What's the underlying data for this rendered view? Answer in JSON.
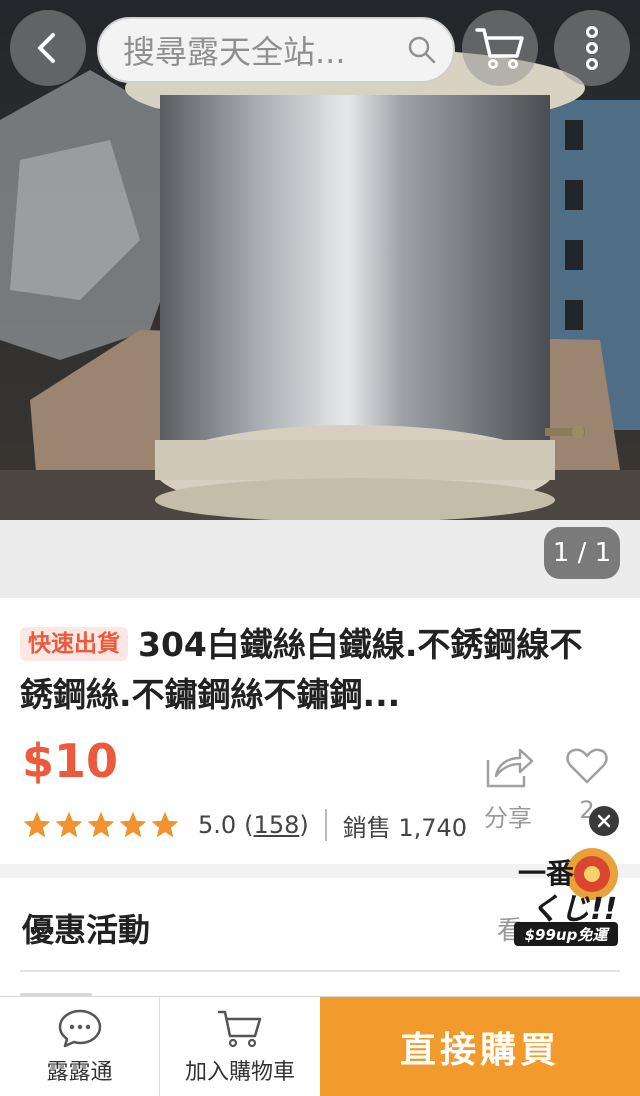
{
  "search": {
    "placeholder": "搜尋露天全站..."
  },
  "gallery": {
    "counter": "1 / 1"
  },
  "product": {
    "badge": "快速出貨",
    "title": "304白鐵絲白鐵線.不銹鋼線不銹鋼絲.不鏽鋼絲不鏽鋼...",
    "price": "$10",
    "rating": "5.0",
    "rating_stars": 5,
    "review_count_open": "(",
    "review_count": "158",
    "review_count_close": ")",
    "sales": "銷售 1,740",
    "share_label": "分享",
    "like_count": "2"
  },
  "promo": {
    "title": "優惠活動",
    "see_more": "看"
  },
  "ad": {
    "line1": "一番",
    "line2": "くじ!!",
    "strip": "$99up免運"
  },
  "bottom_bar": {
    "chat_label": "露露通",
    "cart_label": "加入購物車",
    "buy_label": "直接購買"
  },
  "colors": {
    "accent": "#ec5a3b",
    "star": "#f0922d",
    "buy_button": "#f29b2c"
  },
  "icons": [
    "back-icon",
    "search-icon",
    "cart-icon",
    "more-icon",
    "share-icon",
    "heart-icon",
    "close-icon",
    "chat-icon",
    "star-icon"
  ]
}
